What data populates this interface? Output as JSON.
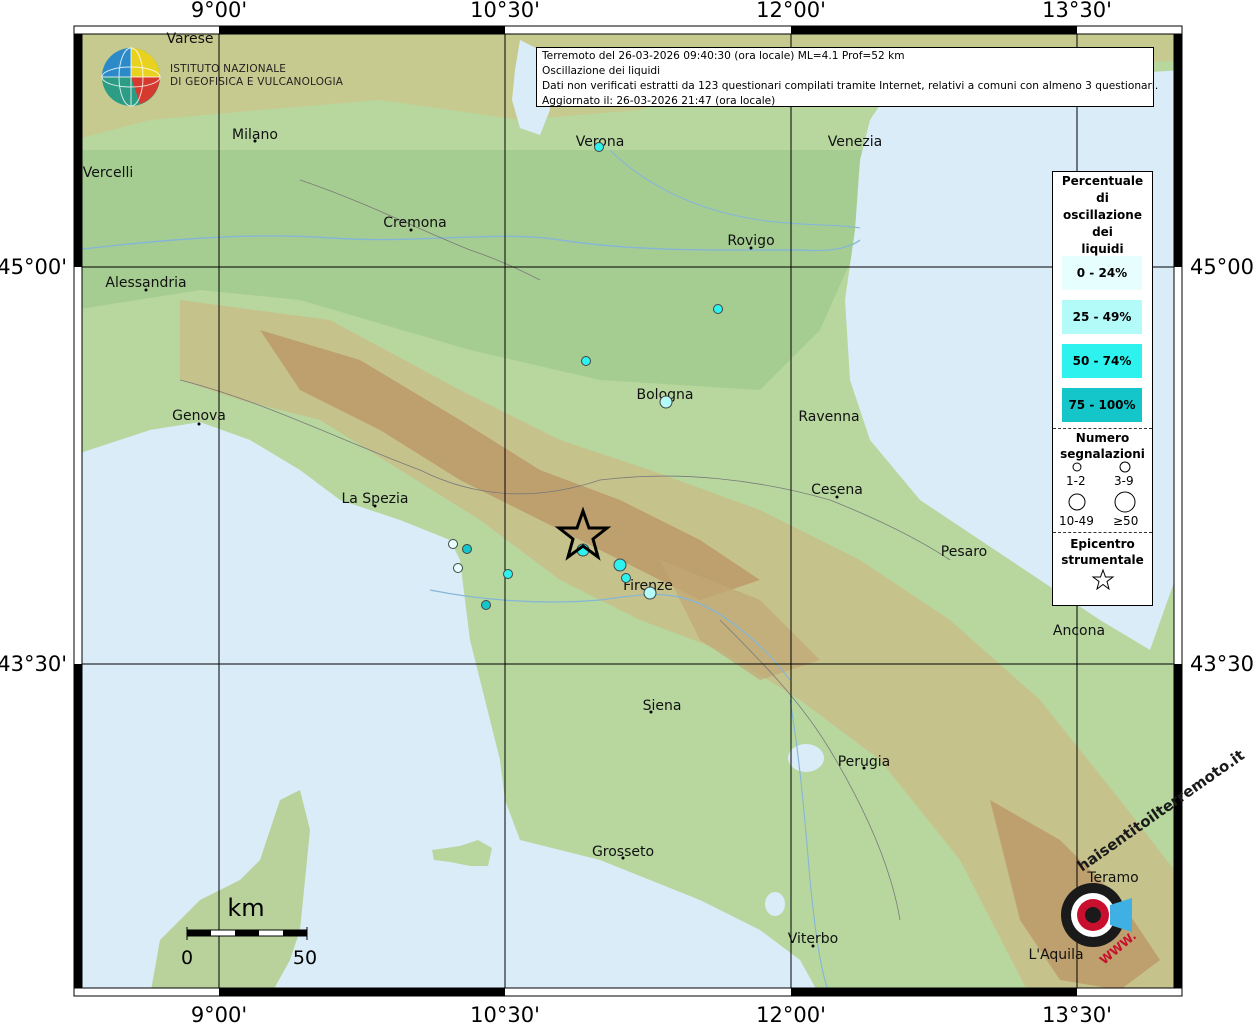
{
  "header": {
    "line1": "Terremoto del 26-03-2026 09:40:30 (ora locale) ML=4.1 Prof=52 km",
    "line2": "Oscillazione dei liquidi",
    "line3": "Dati non verificati estratti da 123 questionari compilati tramite Internet, relativi a comuni con almeno 3 questionari.",
    "line4": "Aggiornato il: 26-03-2026 21:47 (ora locale)"
  },
  "logo": {
    "line1": "ISTITUTO NAZIONALE",
    "line2": "DI GEOFISICA E VULCANOLOGIA"
  },
  "axes": {
    "top": [
      "9°00'",
      "10°30'",
      "12°00'",
      "13°30'"
    ],
    "bottom": [
      "9°00'",
      "10°30'",
      "12°00'",
      "13°30'"
    ],
    "left": [
      "45°00'",
      "43°30'"
    ],
    "right": [
      "45°00'",
      "43°30'"
    ]
  },
  "cities": {
    "varese": "Varese",
    "milano": "Milano",
    "vercelli": "Vercelli",
    "cremona": "Cremona",
    "verona": "Verona",
    "venezia": "Venezia",
    "rovigo": "Rovigo",
    "alessandria": "Alessandria",
    "bologna": "Bologna",
    "ravenna": "Ravenna",
    "genova": "Genova",
    "cesena": "Cesena",
    "la_spezia": "La Spezia",
    "pesaro": "Pesaro",
    "firenze": "Firenze",
    "ancona": "Ancona",
    "siena": "Siena",
    "perugia": "Perugia",
    "grosseto": "Grosseto",
    "teramo": "Teramo",
    "viterbo": "Viterbo",
    "laquila": "L'Aquila"
  },
  "legend": {
    "title": [
      "Percentuale",
      "di",
      "oscillazione",
      "dei",
      "liquidi"
    ],
    "classes": [
      {
        "label": "0 - 24%",
        "color": "#e6fffe"
      },
      {
        "label": "25 - 49%",
        "color": "#b3fbf8"
      },
      {
        "label": "50 - 74%",
        "color": "#2ef2ee"
      },
      {
        "label": "75 - 100%",
        "color": "#14c6c9"
      }
    ],
    "count_title": [
      "Numero",
      "segnalazioni"
    ],
    "count_labels": [
      "1-2",
      "3-9",
      "10-49",
      "≥50"
    ],
    "epicenter_title": [
      "Epicentro",
      "strumentale"
    ]
  },
  "scale": {
    "unit": "km",
    "start": "0",
    "end": "50"
  },
  "watermark": {
    "text": "haisentitoilterremoto.it",
    "url": "WWW."
  },
  "colors": {
    "sea": "#d9ecf7",
    "plain": "#a9cf92",
    "hill": "#c9c48d",
    "mountain": "#b98c5c",
    "epicenter": "#000000"
  }
}
